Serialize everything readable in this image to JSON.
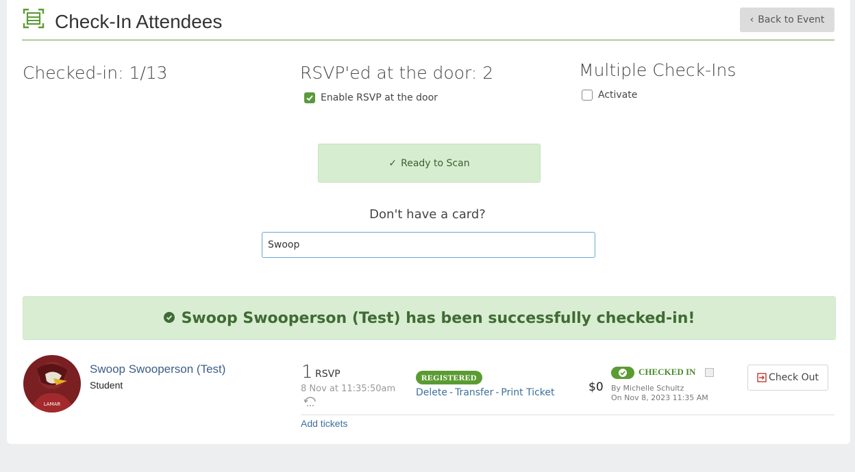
{
  "header": {
    "title": "Check-In Attendees",
    "back_label": "Back to Event"
  },
  "stats": {
    "checked_in": "Checked-in: 1/13",
    "rsvp_door": "RSVP'ed at the door: 2",
    "multiple": "Multiple Check-Ins"
  },
  "options": {
    "enable_rsvp_label": "Enable RSVP at the door",
    "enable_rsvp_checked": true,
    "activate_label": "Activate",
    "activate_checked": false
  },
  "scan": {
    "label": "Ready to Scan"
  },
  "search": {
    "prompt": "Don't have a card?",
    "value": "Swoop"
  },
  "alert": {
    "message": "Swoop Swooperson (Test) has been successfully checked-in!"
  },
  "attendee": {
    "name": "Swoop Swooperson (Test)",
    "role": "Student",
    "quantity": "1",
    "quantity_label": "RSVP",
    "date": "8 Nov at 11:35:50am",
    "add_tickets": "Add tickets",
    "status_badge": "REGISTERED",
    "actions": {
      "delete": "Delete",
      "transfer": "Transfer",
      "print": "Print Ticket"
    },
    "price": "$0",
    "checkin_status": "CHECKED IN",
    "checked_by": "By Michelle Schultz",
    "checked_on": "On Nov 8, 2023 11:35 AM",
    "checkout_label": "Check Out"
  },
  "colors": {
    "accent": "#5a9b32",
    "link": "#3b6e9c",
    "success_bg": "#d9edd2"
  }
}
